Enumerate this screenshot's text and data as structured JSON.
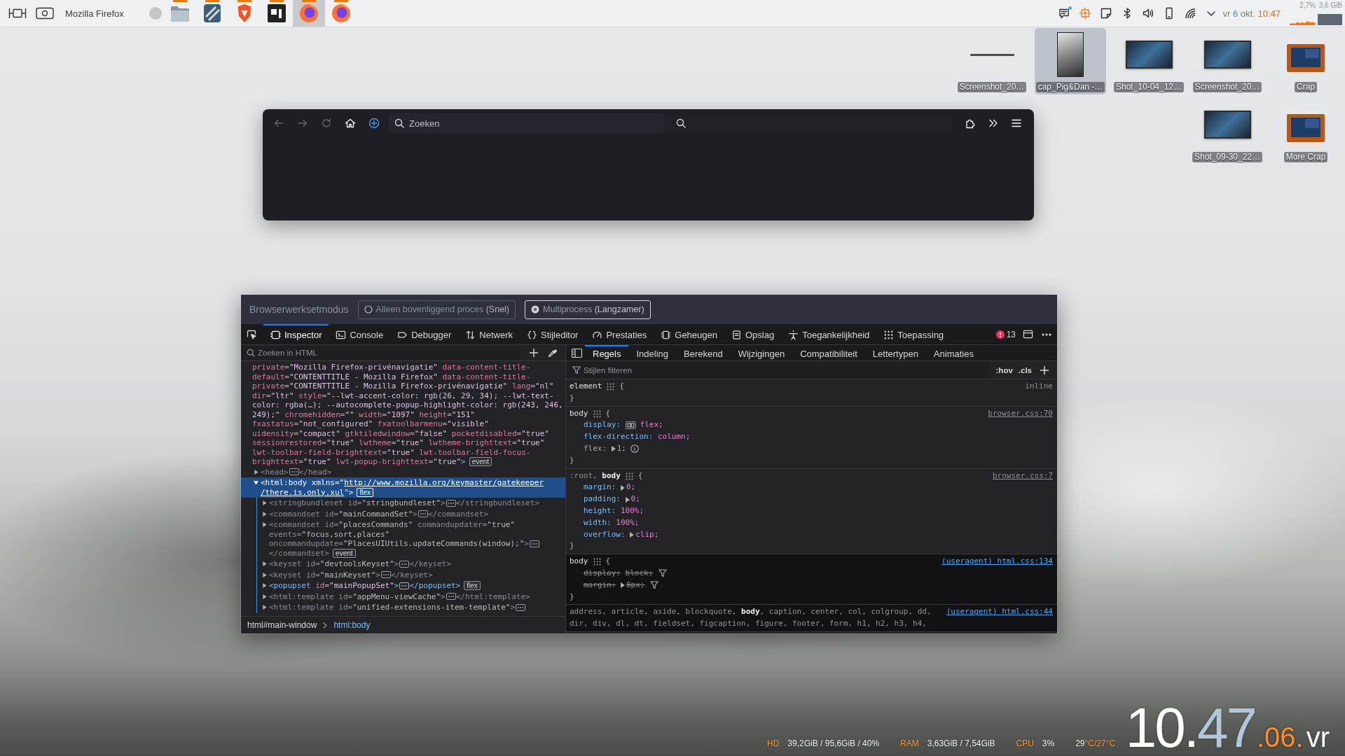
{
  "panel": {
    "window_title": "Mozilla Firefox",
    "tasks": [
      {
        "kind": "folder",
        "running": true,
        "selected": false
      },
      {
        "kind": "pattern",
        "running": true,
        "selected": false
      },
      {
        "kind": "shield",
        "running": true,
        "selected": false
      },
      {
        "kind": "tile",
        "running": true,
        "selected": false
      },
      {
        "kind": "globe",
        "running": true,
        "selected": true
      },
      {
        "kind": "globe",
        "running": true,
        "selected": false
      }
    ],
    "tray": [
      {
        "kind": "notes",
        "unread": true
      },
      {
        "kind": "update",
        "unread": false
      },
      {
        "kind": "sticky",
        "unread": false
      },
      {
        "kind": "bluetooth",
        "unread": false
      },
      {
        "kind": "volume",
        "unread": false
      },
      {
        "kind": "phone",
        "unread": false
      },
      {
        "kind": "wifi",
        "unread": false
      },
      {
        "kind": "expand",
        "unread": false
      }
    ],
    "clock": {
      "day": "vr",
      "date": "6",
      "month": "okt.",
      "time": "10:47"
    },
    "monitor": {
      "cpu": "2,7%",
      "memory": "3,6 GiB"
    }
  },
  "desktop_icons": [
    [
      {
        "label": "Screenshot_20…",
        "kind": "line",
        "selected": false
      },
      {
        "label": "cap_Pig&Dan -…",
        "kind": "portrait",
        "selected": true
      },
      {
        "label": "Shot_10-04_12…",
        "kind": "screenshot",
        "selected": false
      },
      {
        "label": "Screenshot_20…",
        "kind": "screenshot",
        "selected": false
      },
      {
        "label": "Crap",
        "kind": "folder",
        "selected": false
      }
    ],
    [
      {
        "label": "Shot_09-30_22…",
        "kind": "screenshot",
        "selected": false
      },
      {
        "label": "More Crap",
        "kind": "folder",
        "selected": false
      }
    ]
  ],
  "browser": {
    "nav": [
      {
        "kind": "back",
        "disabled": true
      },
      {
        "kind": "forward",
        "disabled": true
      },
      {
        "kind": "reload",
        "disabled": true
      },
      {
        "kind": "home",
        "disabled": false
      },
      {
        "kind": "account",
        "disabled": false
      }
    ],
    "url": {
      "placeholder": "Zoeken"
    }
  },
  "devtools": {
    "mode": {
      "label": "Browserwerksetmodus",
      "options": [
        {
          "label": "Alleen bovenliggend proces",
          "note": "(Snel)",
          "selected": false
        },
        {
          "label": "Multiprocess",
          "note": "(Langzamer)",
          "selected": true
        }
      ]
    },
    "tabs": [
      {
        "kind": "inspector",
        "label": "Inspector",
        "selected": true
      },
      {
        "kind": "console",
        "label": "Console",
        "selected": false
      },
      {
        "kind": "debugger",
        "label": "Debugger",
        "selected": false
      },
      {
        "kind": "network",
        "label": "Netwerk",
        "selected": false
      },
      {
        "kind": "style",
        "label": "Stijleditor",
        "selected": false
      },
      {
        "kind": "performance",
        "label": "Prestaties",
        "selected": false
      },
      {
        "kind": "memory",
        "label": "Geheugen",
        "selected": false
      },
      {
        "kind": "storage",
        "label": "Opslag",
        "selected": false
      },
      {
        "kind": "accessibility",
        "label": "Toegankelijkheid",
        "selected": false
      },
      {
        "kind": "application",
        "label": "Toepassing",
        "selected": false
      }
    ],
    "error_count": "13",
    "inspector": {
      "search": {
        "placeholder": "Zoeken in HTML"
      },
      "markup": {
        "wrapped_lines": [
          "private=\"Mozilla Firefox-privénavigatie\" data-content-title-",
          "default=\"CONTENTTITLE - Mozilla Firefox\" data-content-title-",
          "private=\"CONTENTTITLE - Mozilla Firefox-privénavigatie\" lang=\"nl\"",
          "dir=\"ltr\" style=\"--lwt-accent-color: rgb(26, 29, 34); --lwt-text-",
          "color: rgba(…); --autocomplete-popup-highlight-color: rgb(243, 246,",
          "249);\" chromehidden=\"\" width=\"1097\" height=\"151\"",
          "fxastatus=\"not_configured\" fxatoolbarmenu=\"visible\"",
          "uidensity=\"compact\" gtktiledwindow=\"false\" pocketdisabled=\"true\"",
          "sessionrestored=\"true\" lwtheme=\"true\" lwtheme-brighttext=\"true\"",
          "lwt-toolbar-field-brighttext=\"true\" lwt-toolbar-field-focus-",
          "brighttext=\"true\" lwt-popup-brighttext=\"true\">"
        ],
        "badge": "event",
        "children": [
          {
            "lines": [
              "<head>"
            ],
            "ellipsis": true,
            "close": "</head>",
            "close_wrapped": false,
            "expanded": false,
            "dimmed": true,
            "selected": false
          },
          {
            "lines": [
              "<html:body xmlns=\"http://www.mozilla.org/keymaster/gatekeeper",
              "/there.is.only.xul\">"
            ],
            "ellipsis": false,
            "badge": "flex",
            "expanded": true,
            "dimmed": false,
            "selected": true,
            "children": [
              {
                "lines": [
                  "<stringbundleset id=\"stringbundleset\">"
                ],
                "ellipsis": true,
                "close": "</stringbundleset>",
                "close_wrapped": false,
                "expanded": false,
                "dimmed": true,
                "selected": false
              },
              {
                "lines": [
                  "<commandset id=\"mainCommandSet\">"
                ],
                "ellipsis": true,
                "close": "</commandset>",
                "close_wrapped": false,
                "expanded": false,
                "dimmed": true,
                "selected": false
              },
              {
                "lines": [
                  "<commandset id=\"placesCommands\" commandupdater=\"true\"",
                  "events=\"focus,sort,places\"",
                  "oncommandupdate=\"PlacesUIUtils.updateCommands(window);\">"
                ],
                "ellipsis": true,
                "close": "</commandset>",
                "close_wrapped": true,
                "badge": "event",
                "expanded": false,
                "dimmed": true,
                "selected": false
              },
              {
                "lines": [
                  "<keyset id=\"devtoolsKeyset\">"
                ],
                "ellipsis": true,
                "close": "</keyset>",
                "close_wrapped": false,
                "expanded": false,
                "dimmed": true,
                "selected": false
              },
              {
                "lines": [
                  "<keyset id=\"mainKeyset\">"
                ],
                "ellipsis": true,
                "close": "</keyset>",
                "close_wrapped": false,
                "expanded": false,
                "dimmed": true,
                "selected": false
              },
              {
                "lines": [
                  "<popupset id=\"mainPopupSet\">"
                ],
                "ellipsis": true,
                "close": "</popupset>",
                "close_wrapped": false,
                "badge": "flex",
                "expanded": false,
                "dimmed": false,
                "selected": false
              },
              {
                "lines": [
                  "<html:template id=\"appMenu-viewCache\">"
                ],
                "ellipsis": true,
                "close": "</html:template>",
                "close_wrapped": false,
                "expanded": false,
                "dimmed": true,
                "selected": false
              },
              {
                "lines": [
                  "<html:template id=\"unified-extensions-item-template\">"
                ],
                "ellipsis": true,
                "expanded": false,
                "dimmed": true,
                "selected": false
              }
            ]
          }
        ]
      },
      "breadcrumbs": [
        {
          "label": "html#main-window",
          "selected": false
        },
        {
          "label": "html:body",
          "selected": true
        }
      ]
    },
    "rules_view": {
      "tabs": [
        {
          "label": "Regels",
          "selected": true
        },
        {
          "label": "Indeling",
          "selected": false
        },
        {
          "label": "Berekend",
          "selected": false
        },
        {
          "label": "Wijzigingen",
          "selected": false
        },
        {
          "label": "Compatibiliteit",
          "selected": false
        },
        {
          "label": "Lettertypen",
          "selected": false
        },
        {
          "label": "Animaties",
          "selected": false
        }
      ],
      "filter": {
        "placeholder": "Stijlen filteren"
      },
      "toggles": [
        ":hov",
        ".cls"
      ],
      "rules": [
        {
          "selector": "element",
          "open": "{",
          "close": "}",
          "source": "inline",
          "kind": "inline"
        },
        {
          "selector": "body",
          "open": "{",
          "close": "}",
          "source": "browser.css:70",
          "kind": "stylesheet",
          "declarations": [
            {
              "property": "display:",
              "value": "flex;",
              "expandable": false,
              "flex_toggle": true,
              "inactive": false,
              "overridden": false
            },
            {
              "property": "flex-direction:",
              "value": "column;",
              "expandable": false,
              "flex_toggle": false,
              "inactive": false,
              "overridden": false
            },
            {
              "property": "flex:",
              "value": "1;",
              "expandable": true,
              "flex_toggle": false,
              "inactive": true,
              "overridden": false
            }
          ]
        },
        {
          "selector": ":root, **body**",
          "open": "{",
          "close": "}",
          "source": "browser.css:7",
          "kind": "stylesheet",
          "declarations": [
            {
              "property": "margin:",
              "value": "0;",
              "expandable": true,
              "flex_toggle": false,
              "inactive": false,
              "overridden": false
            },
            {
              "property": "padding:",
              "value": "0;",
              "expandable": true,
              "flex_toggle": false,
              "inactive": false,
              "overridden": false
            },
            {
              "property": "height:",
              "value": "100%;",
              "expandable": false,
              "flex_toggle": false,
              "inactive": false,
              "overridden": false
            },
            {
              "property": "width:",
              "value": "100%;",
              "expandable": false,
              "flex_toggle": false,
              "inactive": false,
              "overridden": false
            },
            {
              "property": "overflow:",
              "value": "clip;",
              "expandable": true,
              "flex_toggle": false,
              "inactive": false,
              "overridden": false
            }
          ]
        },
        {
          "selector": "body",
          "open": "{",
          "close": "}",
          "source": "(useragent) html.css:134",
          "kind": "useragent",
          "declarations": [
            {
              "property": "display:",
              "value": "block;",
              "expandable": false,
              "flex_toggle": false,
              "inactive": false,
              "overridden": true
            },
            {
              "property": "margin:",
              "value": "8px;",
              "expandable": true,
              "flex_toggle": false,
              "inactive": false,
              "overridden": true
            }
          ]
        },
        {
          "selector": "address, article, aside, blockquote, **body**, caption, center, col, colgroup, dd, dir, div, dl, dt, fieldset, figcaption, figure, footer, form, h1, h2, h3, h4,",
          "source": "(useragent) html.css:44",
          "kind": "useragent"
        }
      ]
    }
  },
  "conky": {
    "stats": [
      {
        "label": "HD",
        "value": "39,2GiB / 95,6GiB / 40%"
      },
      {
        "label": "RAM",
        "value": "3,63GiB / 7,54GiB"
      },
      {
        "label": "CPU",
        "value": "3%"
      }
    ],
    "temperature": {
      "current": "29",
      "rest": "°C/27°C"
    },
    "clock": {
      "hours": "10.",
      "minutes": "47",
      "seconds": ".06.",
      "day": "vr"
    }
  }
}
